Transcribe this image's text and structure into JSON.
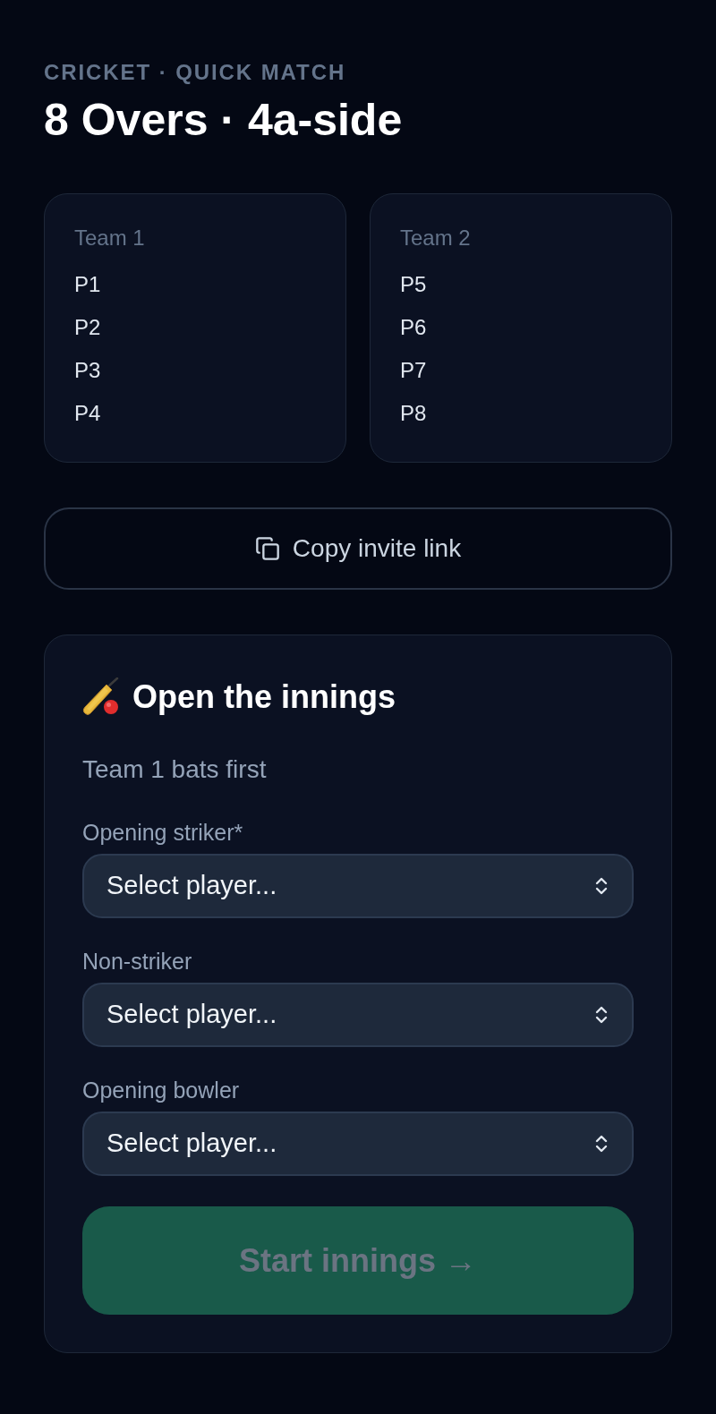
{
  "header": {
    "eyebrow": "CRICKET · QUICK MATCH",
    "title": "8 Overs · 4a-side"
  },
  "teams": [
    {
      "name": "Team 1",
      "players": [
        "P1",
        "P2",
        "P3",
        "P4"
      ]
    },
    {
      "name": "Team 2",
      "players": [
        "P5",
        "P6",
        "P7",
        "P8"
      ]
    }
  ],
  "invite_button": {
    "label": "Copy invite link"
  },
  "innings_setup": {
    "title": "Open the innings",
    "subtitle": "Team 1 bats first",
    "fields": [
      {
        "label": "Opening striker*",
        "placeholder": "Select player..."
      },
      {
        "label": "Non-striker",
        "placeholder": "Select player..."
      },
      {
        "label": "Opening bowler",
        "placeholder": "Select player..."
      }
    ],
    "submit": {
      "label": "Start innings →",
      "disabled": true
    }
  }
}
